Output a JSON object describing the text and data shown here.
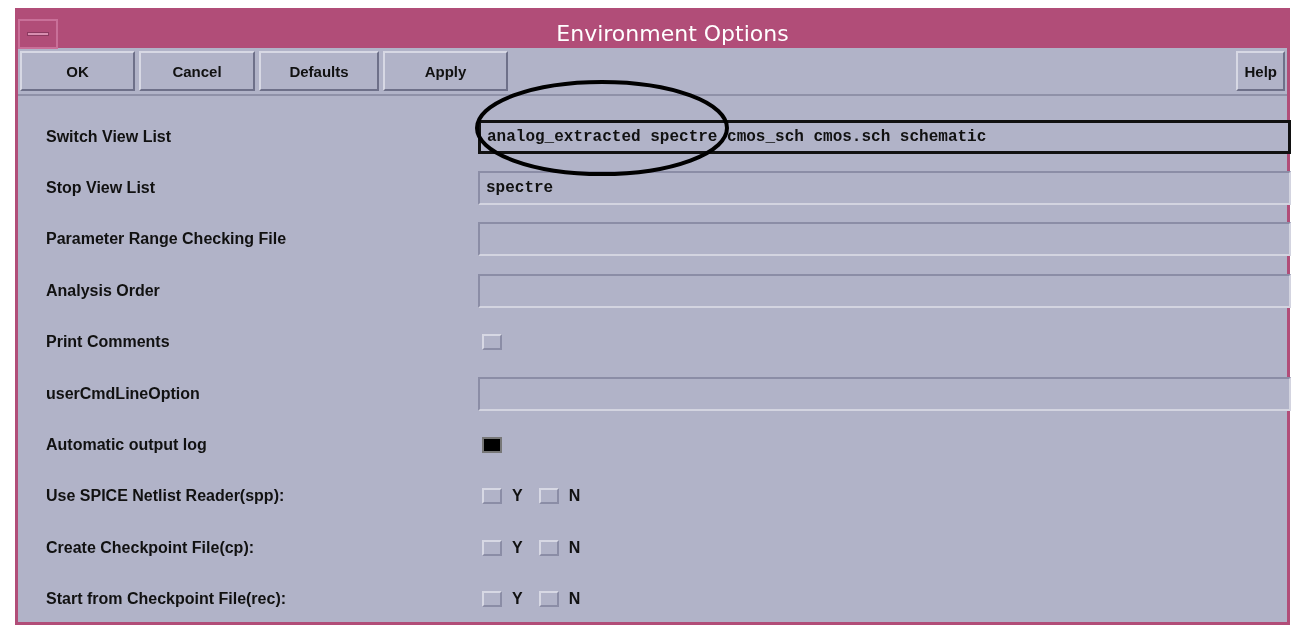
{
  "window": {
    "title": "Environment Options"
  },
  "buttons": [
    {
      "label": "OK"
    },
    {
      "label": "Cancel"
    },
    {
      "label": "Defaults"
    },
    {
      "label": "Apply"
    }
  ],
  "help_button": {
    "label": "Help"
  },
  "rows": [
    {
      "kind": "text",
      "label": "Switch View List",
      "value": "analog_extracted spectre cmos_sch cmos.sch schematic",
      "highlighted": true
    },
    {
      "kind": "text",
      "label": "Stop View List",
      "value": "spectre",
      "highlighted": false
    },
    {
      "kind": "text",
      "label": "Parameter Range Checking File",
      "value": "",
      "highlighted": false
    },
    {
      "kind": "text",
      "label": "Analysis Order",
      "value": "",
      "highlighted": false
    },
    {
      "kind": "checkbox",
      "label": "Print Comments",
      "checked": false
    },
    {
      "kind": "text",
      "label": "userCmdLineOption",
      "value": "",
      "highlighted": false
    },
    {
      "kind": "checkbox",
      "label": "Automatic output log",
      "checked": true
    },
    {
      "kind": "yesno",
      "label": "Use SPICE Netlist Reader(spp):",
      "options": [
        {
          "label": "Y",
          "checked": false
        },
        {
          "label": "N",
          "checked": false
        }
      ]
    },
    {
      "kind": "yesno",
      "label": "Create Checkpoint File(cp):",
      "options": [
        {
          "label": "Y",
          "checked": false
        },
        {
          "label": "N",
          "checked": false
        }
      ]
    },
    {
      "kind": "yesno",
      "label": "Start from Checkpoint File(rec):",
      "options": [
        {
          "label": "Y",
          "checked": false
        },
        {
          "label": "N",
          "checked": false
        }
      ]
    }
  ]
}
